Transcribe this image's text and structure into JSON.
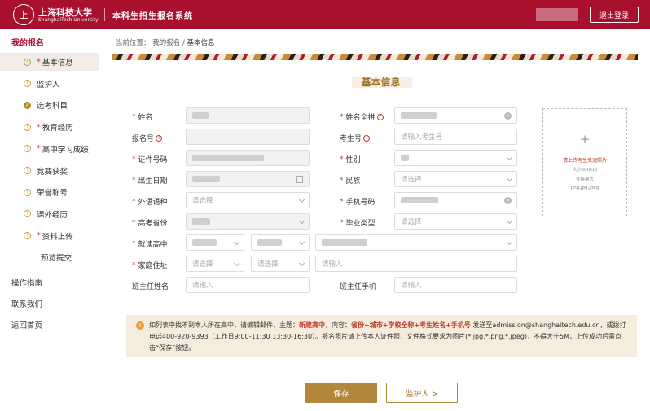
{
  "header": {
    "logo_glyph": "上",
    "university_cn": "上海科技大学",
    "university_en": "ShanghaiTech University",
    "system_title": "本科生招生报名系统",
    "logout_label": "退出登录"
  },
  "sidebar": {
    "title": "我的报名",
    "steps": [
      {
        "label": "基本信息",
        "required": true,
        "status": "pending",
        "active": true
      },
      {
        "label": "监护人",
        "required": false,
        "status": "pending"
      },
      {
        "label": "选考科目",
        "required": false,
        "status": "done"
      },
      {
        "label": "教育经历",
        "required": true,
        "status": "pending"
      },
      {
        "label": "高中学习成绩",
        "required": true,
        "status": "pending"
      },
      {
        "label": "竞赛获奖",
        "required": false,
        "status": "pending"
      },
      {
        "label": "荣誉称号",
        "required": false,
        "status": "pending"
      },
      {
        "label": "课外经历",
        "required": false,
        "status": "pending"
      },
      {
        "label": "资料上传",
        "required": true,
        "status": "pending"
      },
      {
        "label": "预览提交",
        "required": false,
        "status": "none"
      }
    ],
    "menu": [
      "操作指南",
      "联系我们",
      "返回首页"
    ]
  },
  "breadcrumb": {
    "prefix": "当前位置：",
    "parent": "我的报名",
    "sep": "/",
    "current": "基本信息"
  },
  "section_title": "基本信息",
  "form": {
    "name": "姓名",
    "pinyin": "姓名全拼",
    "reg_no": "报名号",
    "exam_no": "考生号",
    "exam_no_ph": "请输入考生号",
    "id_no": "证件号码",
    "gender": "性别",
    "birth": "出生日期",
    "ethnic": "民族",
    "ethnic_ph": "请选择",
    "lang": "外语语种",
    "lang_ph": "请选择",
    "phone": "手机号码",
    "province": "高考省份",
    "grad_type": "毕业类型",
    "grad_type_ph": "请选择",
    "school": "就读高中",
    "address": "家庭住址",
    "addr_p1": "请选择",
    "addr_p2": "请选择",
    "addr_ph": "请输入",
    "teacher": "班主任姓名",
    "teacher_ph": "请输入",
    "teacher_phone": "班主任手机",
    "teacher_phone_ph": "请输入"
  },
  "photo": {
    "plus": "+",
    "upload": "请上传考生免冠照片",
    "size": "大小200K内",
    "formats_label": "支持格式",
    "formats": "png,jpg,jpeg"
  },
  "notice": {
    "icon": "!",
    "p1": "如列表中找不到本人所在高中，请编辑邮件，主题：",
    "subject": "新建高中",
    "p2": "，内容：",
    "content": "省份+城市+学校全称+考生姓名+手机号",
    "p3": " 发送至admission@shanghaitech.edu.cn，或拨打电话400-920-9393（工作日9:00-11:30 13:30-16:30）。报名照片请上传本人证件照，文件格式要求为图片(*.jpg,*.png,*.jpeg)，不得大于5M，上传成功后需点击“保存”按钮。"
  },
  "buttons": {
    "save": "保存",
    "next": "监护人 >"
  }
}
